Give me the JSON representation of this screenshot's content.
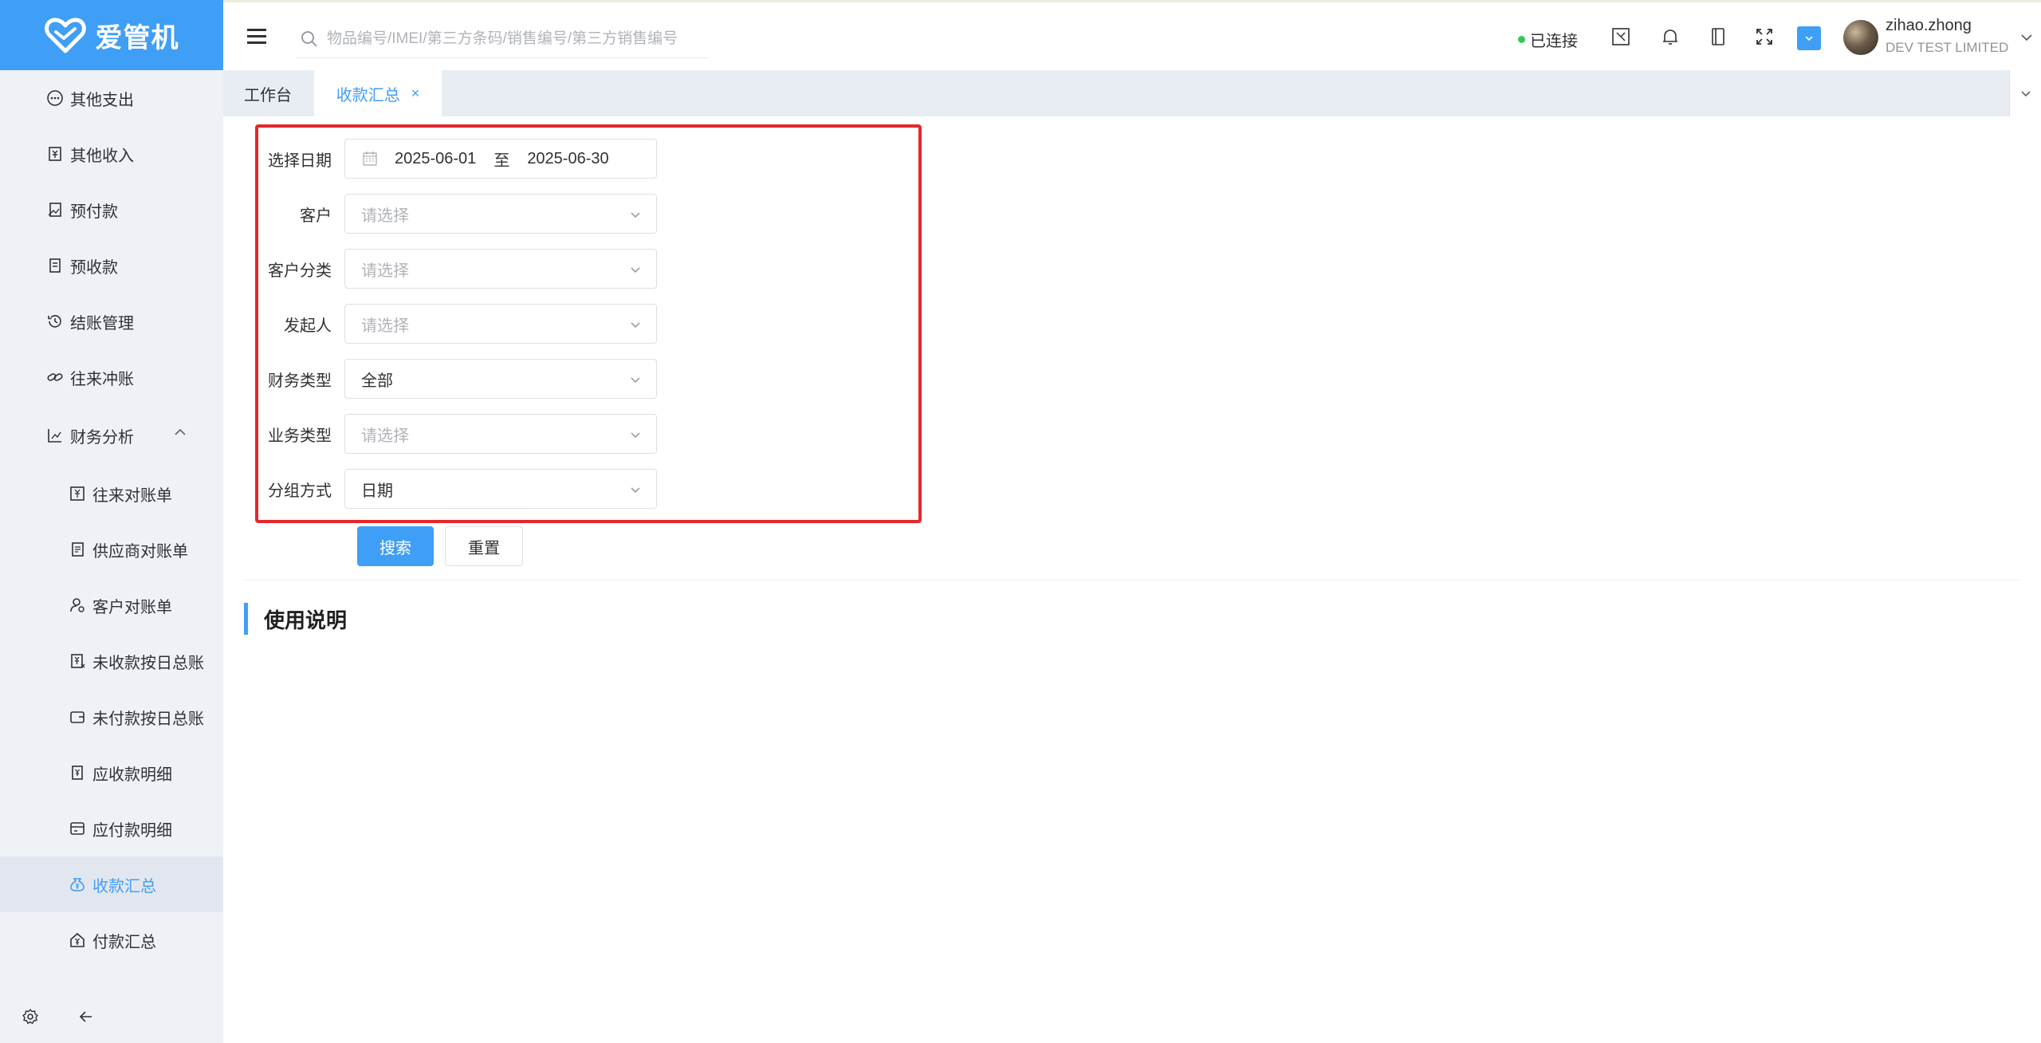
{
  "brand": {
    "name": "爱管机",
    "color": "#3f9ef5"
  },
  "sidebar": {
    "items": [
      {
        "label": "其他支出",
        "icon": "ellipsis-circle-icon",
        "level": 1
      },
      {
        "label": "其他收入",
        "icon": "receipt-icon",
        "level": 1
      },
      {
        "label": "预付款",
        "icon": "chart-doc-icon",
        "level": 1
      },
      {
        "label": "预收款",
        "icon": "document-icon",
        "level": 1
      },
      {
        "label": "结账管理",
        "icon": "history-icon",
        "level": 1
      },
      {
        "label": "往来冲账",
        "icon": "link-icon",
        "level": 1
      },
      {
        "label": "财务分析",
        "icon": "bar-chart-icon",
        "level": 1,
        "expanded": true
      },
      {
        "label": "往来对账单",
        "icon": "yen-box-icon",
        "level": 2
      },
      {
        "label": "供应商对账单",
        "icon": "file-list-icon",
        "level": 2
      },
      {
        "label": "客户对账单",
        "icon": "user-settings-icon",
        "level": 2
      },
      {
        "label": "未收款按日总账",
        "icon": "yen-doc-icon",
        "level": 2
      },
      {
        "label": "未付款按日总账",
        "icon": "wallet-icon",
        "level": 2
      },
      {
        "label": "应收款明细",
        "icon": "doc-yen-icon",
        "level": 2
      },
      {
        "label": "应付款明细",
        "icon": "card-icon",
        "level": 2
      },
      {
        "label": "收款汇总",
        "icon": "money-bag-icon",
        "level": 2,
        "active": true
      },
      {
        "label": "付款汇总",
        "icon": "house-yen-icon",
        "level": 2
      }
    ],
    "footer": {
      "settings_icon": "gear-icon",
      "collapse_icon": "arrow-left-icon"
    }
  },
  "header": {
    "search_placeholder": "物品编号/IMEI/第三方条码/销售编号/第三方销售编号",
    "status_text": "已连接",
    "user_name": "zihao.zhong",
    "company": "DEV TEST LIMITED"
  },
  "tabs": [
    {
      "label": "工作台",
      "active": false
    },
    {
      "label": "收款汇总",
      "active": true,
      "close": "×"
    }
  ],
  "form": {
    "date_label": "选择日期",
    "date_start": "2025-06-01",
    "date_separator": "至",
    "date_end": "2025-06-30",
    "fields": [
      {
        "label": "客户",
        "value": "",
        "placeholder": "请选择"
      },
      {
        "label": "客户分类",
        "value": "",
        "placeholder": "请选择"
      },
      {
        "label": "发起人",
        "value": "",
        "placeholder": "请选择"
      },
      {
        "label": "财务类型",
        "value": "全部",
        "placeholder": ""
      },
      {
        "label": "业务类型",
        "value": "",
        "placeholder": "请选择"
      },
      {
        "label": "分组方式",
        "value": "日期",
        "placeholder": ""
      }
    ],
    "search_button": "搜索",
    "reset_button": "重置"
  },
  "section": {
    "title": "使用说明"
  },
  "colors": {
    "accent": "#3f9ef5",
    "highlight_border": "#e8262b",
    "status_online": "#34c759"
  }
}
